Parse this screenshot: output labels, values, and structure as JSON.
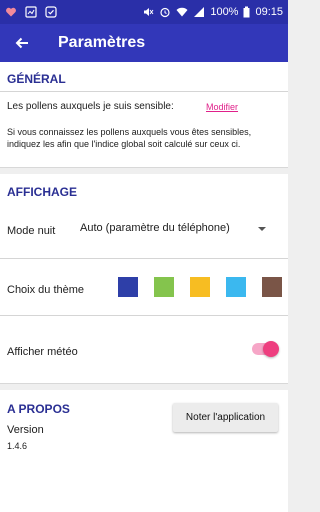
{
  "status_bar": {
    "battery_percent": "100%",
    "time": "09:15"
  },
  "app_bar": {
    "title": "Paramètres"
  },
  "general": {
    "title": "GÉNÉRAL",
    "pollen_label": "Les pollens auxquels je suis sensible:",
    "modify_link": "Modifier",
    "help_line1": "Si vous connaissez les pollens auxquels vous êtes sensibles,",
    "help_line2": "indiquez les afin que l'indice global soit calculé sur ceux ci."
  },
  "display": {
    "title": "AFFICHAGE",
    "night_mode_label": "Mode nuit",
    "night_mode_value": "Auto (paramètre du téléphone)",
    "theme_label": "Choix du thème",
    "theme_colors": [
      "#2e3fa8",
      "#84c44d",
      "#f7bd22",
      "#3bb8ef",
      "#7a5547"
    ],
    "weather_label": "Afficher météo",
    "weather_on": true
  },
  "about": {
    "title": "A PROPOS",
    "version_label": "Version",
    "version_value": "1.4.6",
    "rate_button": "Noter l'application"
  },
  "colors": {
    "primary": "#3237b9",
    "primary_dark": "#2a2fa8",
    "accent": "#ee3e7f",
    "section_title": "#2a2f93"
  }
}
